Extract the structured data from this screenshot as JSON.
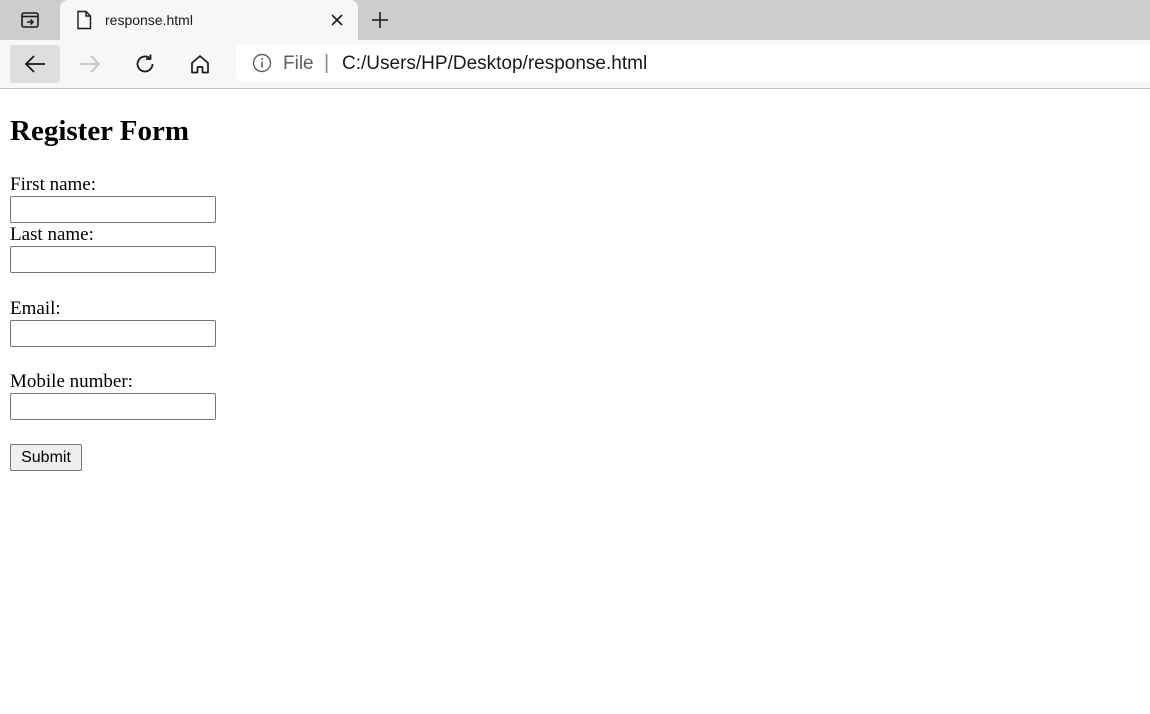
{
  "browser": {
    "tab": {
      "title": "response.html"
    },
    "address_bar": {
      "scheme_label": "File",
      "separator": "|",
      "url": "C:/Users/HP/Desktop/response.html"
    },
    "icons": {
      "tab_actions": "tab-actions-icon",
      "page": "document-icon",
      "close": "close-icon",
      "new_tab": "plus-icon",
      "back": "arrow-left-icon",
      "forward": "arrow-right-icon",
      "refresh": "refresh-icon",
      "home": "home-icon",
      "info": "info-icon"
    },
    "colors": {
      "tabstrip": "#cdcdcd",
      "toolbar": "#f7f7f7"
    }
  },
  "page": {
    "heading": "Register Form",
    "fields": [
      {
        "label": "First name:",
        "value": ""
      },
      {
        "label": "Last name:",
        "value": ""
      },
      {
        "label": "Email:",
        "value": ""
      },
      {
        "label": "Mobile number:",
        "value": ""
      }
    ],
    "submit_label": "Submit"
  }
}
